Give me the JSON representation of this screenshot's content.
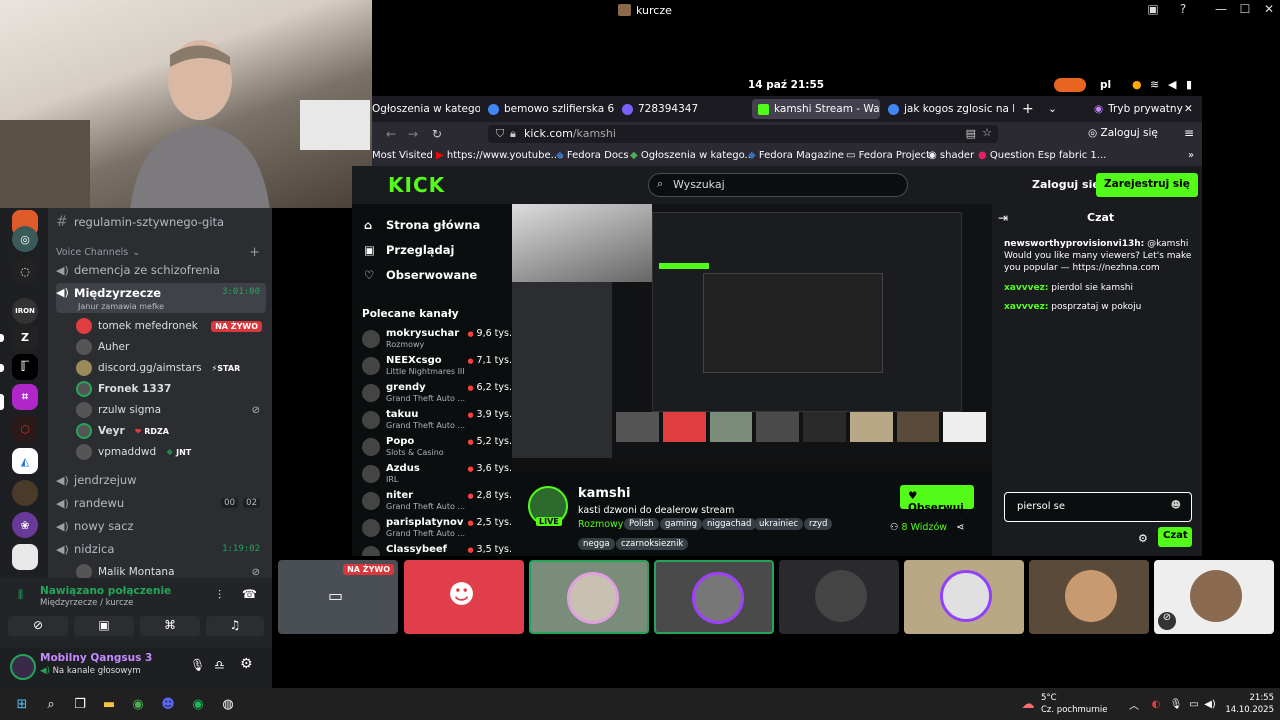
{
  "window": {
    "title": "kurcze"
  },
  "desktop": {
    "date_time": "14 paź  21:55",
    "lang": "pl"
  },
  "browser": {
    "tabs": [
      {
        "label": "Ogłoszenia w kategori",
        "color": "#2e7d32"
      },
      {
        "label": "bemowo szlifierska 6",
        "color": "#4285f4"
      },
      {
        "label": "728394347",
        "color": "#7b61ff"
      },
      {
        "label": "kamshi Stream - Watc",
        "color": "#53fc18"
      },
      {
        "label": "jak kogos zglosic na k",
        "color": "#4285f4"
      }
    ],
    "private_label": "Tryb prywatny",
    "url_domain": "kick.com",
    "url_path": "/kamshi",
    "login_label": "Zaloguj się",
    "bookmarks": [
      "Most Visited",
      "https://www.youtube....",
      "Fedora Docs",
      "Ogłoszenia w katego...",
      "Fedora Magazine",
      "Fedora Project",
      "shader",
      "Question Esp fabric 1..."
    ]
  },
  "kick": {
    "logo": "KICK",
    "search_placeholder": "Wyszukaj",
    "login": "Zaloguj się",
    "register": "Zarejestruj się",
    "nav": [
      "Strona główna",
      "Przeglądaj",
      "Obserwowane"
    ],
    "recommended_title": "Polecane kanały",
    "recommended": [
      {
        "name": "mokrysuchar",
        "cat": "Rozmowy",
        "viewers": "9,6 tys."
      },
      {
        "name": "NEEXcsgo",
        "cat": "Little Nightmares III",
        "viewers": "7,1 tys."
      },
      {
        "name": "grendy",
        "cat": "Grand Theft Auto ...",
        "viewers": "6,2 tys."
      },
      {
        "name": "takuu",
        "cat": "Grand Theft Auto ...",
        "viewers": "3,9 tys."
      },
      {
        "name": "Popo",
        "cat": "Slots & Casino",
        "viewers": "5,2 tys."
      },
      {
        "name": "Azdus",
        "cat": "IRL",
        "viewers": "3,6 tys."
      },
      {
        "name": "niter",
        "cat": "Grand Theft Auto ...",
        "viewers": "2,8 tys."
      },
      {
        "name": "parisplatynov",
        "cat": "Grand Theft Auto ...",
        "viewers": "2,5 tys."
      },
      {
        "name": "Classybeef",
        "cat": "",
        "viewers": "3,5 tys."
      }
    ],
    "streamer": {
      "name": "kamshi",
      "title": "kasti dzwoni do dealerow stream",
      "category": "Rozmowy",
      "tags": [
        "Polish",
        "gaming",
        "niggachad",
        "ukrainiec",
        "rzyd",
        "negga",
        "czarnoksieznik"
      ],
      "live": "LIVE",
      "follow": "Obserwuj",
      "viewers": "8 Widzów"
    },
    "chat": {
      "title": "Czat",
      "messages": [
        {
          "user": "newsworthyprovisionvi13h:",
          "text": "@kamshi Would you like many viewers? Let's make you popular — https://nezhna.com"
        },
        {
          "user": "xavvvez:",
          "text": "pierdol sie kamshi"
        },
        {
          "user": "xavvvez:",
          "text": "posprzataj w pokoju"
        }
      ],
      "input_value": "piersol se",
      "send": "Czat"
    }
  },
  "discord": {
    "channel_text": "regulamin-sztywnego-gita",
    "voice_header": "Voice Channels",
    "voice_channels": [
      {
        "name": "demencja ze schizofrenia"
      },
      {
        "name": "Międzyrzecze",
        "time": "3:01:00",
        "sub": "Janur zamawia mefke"
      }
    ],
    "voice_users": [
      {
        "name": "tomek mefedronek",
        "badge": "NA ŻYWO"
      },
      {
        "name": "Auher"
      },
      {
        "name": "discord.gg/aimstars",
        "badge": "STAR"
      },
      {
        "name": "Fronek 1337"
      },
      {
        "name": "rzulw sigma"
      },
      {
        "name": "Veyr",
        "badge": "RDZA"
      },
      {
        "name": "vpmaddwd",
        "badge": "JNT"
      }
    ],
    "channels_after": [
      {
        "name": "jendrzejuw"
      },
      {
        "name": "randewu",
        "a": "00",
        "b": "02"
      },
      {
        "name": "nowy sacz"
      },
      {
        "name": "nidzica",
        "time": "1:19:02"
      }
    ],
    "last_user": "Malik Montana",
    "connection": {
      "status": "Nawiązano połączenie",
      "location": "Międzyrzecze / kurcze"
    },
    "user": {
      "name": "Mobilny Qangsus 3",
      "status": "Na kanale głosowym"
    },
    "tile_live": "NA ŻYWO"
  },
  "taskbar": {
    "temp": "5°C",
    "weather": "Cz. pochmurnie",
    "time": "21:55",
    "date": "14.10.2025"
  }
}
